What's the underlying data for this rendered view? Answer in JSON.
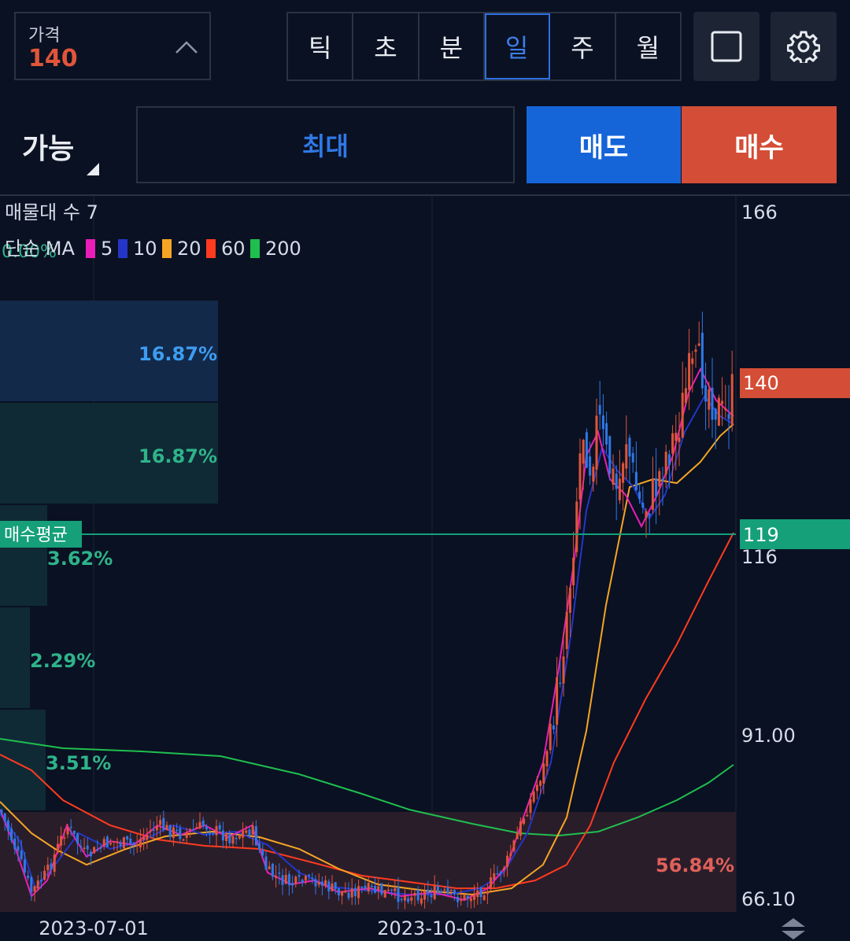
{
  "price_field": {
    "label": "가격",
    "value": "140"
  },
  "interval_tabs": [
    {
      "label": "틱",
      "active": false
    },
    {
      "label": "초",
      "active": false
    },
    {
      "label": "분",
      "active": false
    },
    {
      "label": "일",
      "active": true
    },
    {
      "label": "주",
      "active": false
    },
    {
      "label": "월",
      "active": false
    }
  ],
  "icons": {
    "fullscreen": "square-icon",
    "settings": "gear-icon"
  },
  "order": {
    "available_label": "가능",
    "max_label": "최대",
    "sell_label": "매도",
    "buy_label": "매수"
  },
  "colors": {
    "background": "#0a1122",
    "up": "#e0553a",
    "down": "#2f78e6",
    "sell": "#1565d8",
    "buy": "#d44d36",
    "avg_line": "#15a07a"
  },
  "overlay": {
    "volume_profile_label": "매물대 수 7",
    "ma_title": "단순 MA",
    "ma_periods": [
      {
        "period": "5",
        "color": "#e91eb8"
      },
      {
        "period": "10",
        "color": "#2436c8"
      },
      {
        "period": "20",
        "color": "#f5a524"
      },
      {
        "period": "60",
        "color": "#ff3b1f"
      },
      {
        "period": "200",
        "color": "#1fbf4f"
      }
    ],
    "hidden_pct": "0.00%"
  },
  "avg_price": {
    "label": "매수평균",
    "value": "119"
  },
  "current_price_tag": "140",
  "chart_data": {
    "type": "candlestick",
    "y_ticks": [
      "166",
      "116",
      "91.00",
      "66.10"
    ],
    "x_ticks": [
      "2023-07-01",
      "2023-10-01"
    ],
    "volume_profile": [
      {
        "pct": "16.87%",
        "color": "#3d9cf0"
      },
      {
        "pct": "16.87%",
        "color": "#2fb38a"
      },
      {
        "pct": "3.62%",
        "color": "#2fb38a"
      },
      {
        "pct": "2.29%",
        "color": "#2fb38a"
      },
      {
        "pct": "3.51%",
        "color": "#2fb38a"
      },
      {
        "pct": "56.84%",
        "color": "#e0605a"
      }
    ],
    "avg_buy_price": 119,
    "current_price": 140
  }
}
